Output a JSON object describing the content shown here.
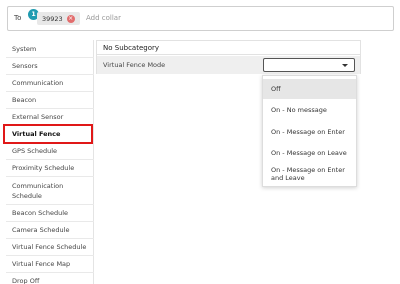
{
  "recipient": {
    "label": "To",
    "count": "1",
    "chip_text": "39923",
    "chip_remove": "×",
    "add_placeholder": "Add collar"
  },
  "sidebar": {
    "items": [
      {
        "label": "System"
      },
      {
        "label": "Sensors"
      },
      {
        "label": "Communication"
      },
      {
        "label": "Beacon"
      },
      {
        "label": "External Sensor"
      },
      {
        "label": "Virtual Fence"
      },
      {
        "label": "GPS Schedule"
      },
      {
        "label": "Proximity Schedule"
      },
      {
        "label": "Communication Schedule"
      },
      {
        "label": "Beacon Schedule"
      },
      {
        "label": "Camera Schedule"
      },
      {
        "label": "Virtual Fence Schedule"
      },
      {
        "label": "Virtual Fence Map"
      },
      {
        "label": "Drop Off"
      }
    ],
    "active": "Virtual Fence"
  },
  "panel": {
    "header": "No Subcategory",
    "row_label": "Virtual Fence Mode",
    "select_value": ""
  },
  "dropdown": {
    "options": [
      {
        "label": "Off"
      },
      {
        "label": "On - No message"
      },
      {
        "label": "On - Message on Enter"
      },
      {
        "label": "On - Message on Leave"
      },
      {
        "label": "On - Message on Enter and Leave"
      }
    ],
    "highlighted": "Off"
  },
  "colors": {
    "badge": "#1f9bb0",
    "chip_remove": "#e26d6d",
    "active_outline": "#e01818"
  }
}
